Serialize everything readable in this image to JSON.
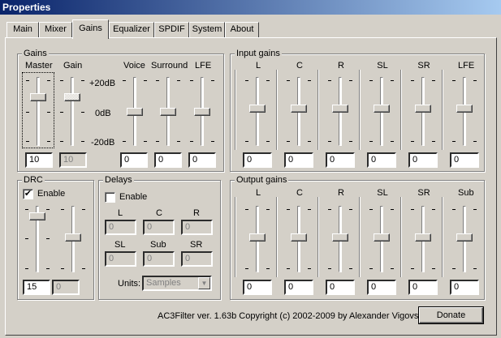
{
  "window": {
    "title": "Properties"
  },
  "tabs": [
    {
      "label": "Main"
    },
    {
      "label": "Mixer"
    },
    {
      "label": "Gains",
      "active": true
    },
    {
      "label": "Equalizer"
    },
    {
      "label": "SPDIF"
    },
    {
      "label": "System"
    },
    {
      "label": "About"
    }
  ],
  "gains": {
    "title": "Gains",
    "master_label": "Master",
    "gain_label": "Gain",
    "scale": {
      "top": "+20dB",
      "mid": "0dB",
      "bottom": "-20dB"
    },
    "voice_label": "Voice",
    "surround_label": "Surround",
    "lfe_label": "LFE",
    "master_value": "10",
    "gain_value": "10",
    "voice_value": "0",
    "surround_value": "0",
    "lfe_value": "0"
  },
  "input_gains": {
    "title": "Input gains",
    "channels": [
      {
        "label": "L",
        "value": "0"
      },
      {
        "label": "C",
        "value": "0"
      },
      {
        "label": "R",
        "value": "0"
      },
      {
        "label": "SL",
        "value": "0"
      },
      {
        "label": "SR",
        "value": "0"
      },
      {
        "label": "LFE",
        "value": "0"
      }
    ]
  },
  "drc": {
    "title": "DRC",
    "enable_label": "Enable",
    "enabled": true,
    "value1": "15",
    "value2": "0"
  },
  "delays": {
    "title": "Delays",
    "enable_label": "Enable",
    "enabled": false,
    "row1": [
      {
        "label": "L",
        "value": "0"
      },
      {
        "label": "C",
        "value": "0"
      },
      {
        "label": "R",
        "value": "0"
      }
    ],
    "row2": [
      {
        "label": "SL",
        "value": "0"
      },
      {
        "label": "Sub",
        "value": "0"
      },
      {
        "label": "SR",
        "value": "0"
      }
    ],
    "units_label": "Units:",
    "units_value": "Samples"
  },
  "output_gains": {
    "title": "Output gains",
    "channels": [
      {
        "label": "L",
        "value": "0"
      },
      {
        "label": "C",
        "value": "0"
      },
      {
        "label": "R",
        "value": "0"
      },
      {
        "label": "SL",
        "value": "0"
      },
      {
        "label": "SR",
        "value": "0"
      },
      {
        "label": "Sub",
        "value": "0"
      }
    ]
  },
  "footer": {
    "copyright": "AC3Filter ver. 1.63b Copyright (c) 2002-2009 by Alexander Vigovsky",
    "donate_label": "Donate"
  },
  "colors": {
    "titlebar_start": "#0a246a",
    "titlebar_end": "#a6caf0",
    "face": "#d4d0c8"
  }
}
